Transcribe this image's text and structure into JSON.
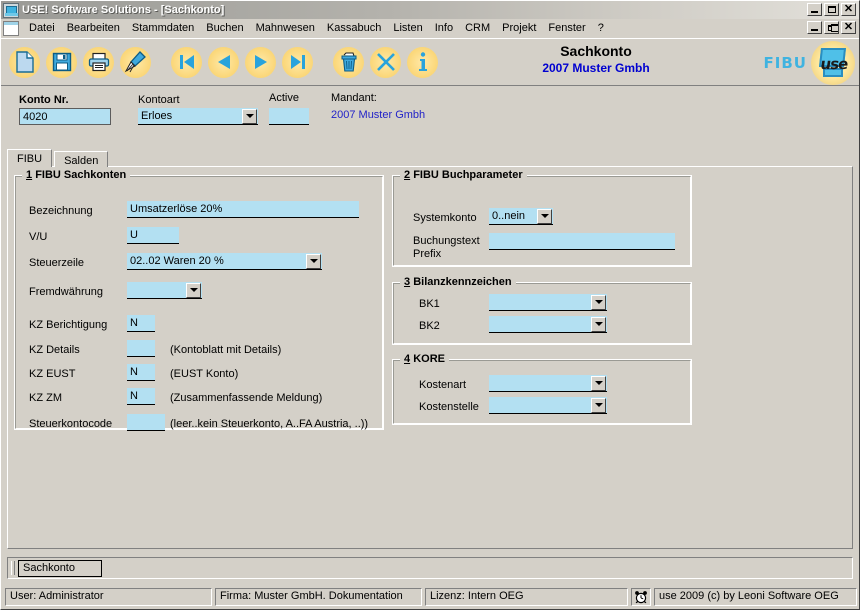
{
  "window": {
    "title": "USE! Software Solutions - [Sachkonto]",
    "icon": "use-logo-icon",
    "buttons": {
      "minimize": "minimize-icon",
      "maximize": "maximize-icon",
      "close": "close-icon",
      "mdi_minimize": "mdi-minimize-icon",
      "mdi_restore": "mdi-restore-icon",
      "mdi_close": "mdi-close-icon"
    }
  },
  "menu": {
    "items": [
      "Datei",
      "Bearbeiten",
      "Stammdaten",
      "Buchen",
      "Mahnwesen",
      "Kassabuch",
      "Listen",
      "Info",
      "CRM",
      "Projekt",
      "Fenster",
      "?"
    ]
  },
  "toolbar": {
    "buttons": [
      {
        "name": "new-document-icon",
        "tooltip": "Neu"
      },
      {
        "name": "save-icon",
        "tooltip": "Speichern"
      },
      {
        "name": "print-icon",
        "tooltip": "Drucken"
      },
      {
        "name": "broom-clear-icon",
        "tooltip": "Leeren"
      },
      {
        "name": "first-record-icon",
        "tooltip": "Erster"
      },
      {
        "name": "previous-record-icon",
        "tooltip": "Voriger"
      },
      {
        "name": "next-record-icon",
        "tooltip": "Naechster"
      },
      {
        "name": "last-record-icon",
        "tooltip": "Letzter"
      },
      {
        "name": "delete-trash-icon",
        "tooltip": "Loeschen"
      },
      {
        "name": "cancel-x-icon",
        "tooltip": "Abbrechen"
      },
      {
        "name": "info-icon",
        "tooltip": "Info"
      }
    ]
  },
  "header": {
    "title": "Sachkonto",
    "subtitle": "2007 Muster Gmbh",
    "brand_module": "FIBU",
    "brand_logo_text": "use"
  },
  "top_form": {
    "konto_nr": {
      "label": "Konto Nr.",
      "value": "4020"
    },
    "kontoart": {
      "label": "Kontoart",
      "value": "Erloes"
    },
    "active": {
      "label": "Active",
      "value": ""
    },
    "mandant": {
      "label": "Mandant:",
      "value": "2007 Muster Gmbh"
    }
  },
  "tabs": [
    {
      "label": "FIBU",
      "active": true
    },
    {
      "label": "Salden",
      "active": false
    }
  ],
  "group_fibu_sachkonten": {
    "number": "1",
    "title": "FIBU Sachkonten",
    "fields": [
      {
        "label": "Bezeichnung",
        "value": "Umsatzerlöse 20%"
      },
      {
        "label": "V/U",
        "value": "U"
      },
      {
        "label": "Steuerzeile",
        "value": "02..02 Waren 20 %"
      },
      {
        "label": "Fremdwährung",
        "value": ""
      },
      {
        "label": "KZ Berichtigung",
        "value": "N"
      },
      {
        "label": "KZ Details",
        "value": "",
        "hint": "(Kontoblatt mit Details)"
      },
      {
        "label": "KZ EUST",
        "value": "N",
        "hint": "(EUST Konto)"
      },
      {
        "label": "KZ ZM",
        "value": "N",
        "hint": "(Zusammenfassende Meldung)"
      },
      {
        "label": "Steuerkontocode",
        "value": "",
        "hint": "(leer..kein Steuerkonto, A..FA Austria, ..))"
      }
    ]
  },
  "group_buchparameter": {
    "number": "2",
    "title": "FIBU Buchparameter",
    "systemkonto": {
      "label": "Systemkonto",
      "value": "0..nein"
    },
    "buchungstext_prefix": {
      "label_line1": "Buchungstext",
      "label_line2": "Prefix",
      "value": ""
    }
  },
  "group_bilanzkennzeichen": {
    "number": "3",
    "title": "Bilanzkennzeichen",
    "bk1": {
      "label": "BK1",
      "value": ""
    },
    "bk2": {
      "label": "BK2",
      "value": ""
    }
  },
  "group_kore": {
    "number": "4",
    "title": "KORE",
    "kostenart": {
      "label": "Kostenart",
      "value": ""
    },
    "kostenstelle": {
      "label": "Kostenstelle",
      "value": ""
    }
  },
  "taskbar": {
    "button_label": "Sachkonto"
  },
  "statusbar": {
    "user": "User: Administrator",
    "firma": "Firma: Muster GmbH. Dokumentation",
    "lizenz": "Lizenz: Intern OEG",
    "clock_icon": "alarm-clock-icon",
    "copyright": "use 2009 (c) by Leoni Software OEG"
  },
  "colors": {
    "field_blue": "#b3e0f2",
    "face": "#d4d0c8",
    "accent_blue": "#3fb3e0",
    "link_blue": "#2222c8",
    "toolbtn_yellow": "#fbd87c"
  }
}
